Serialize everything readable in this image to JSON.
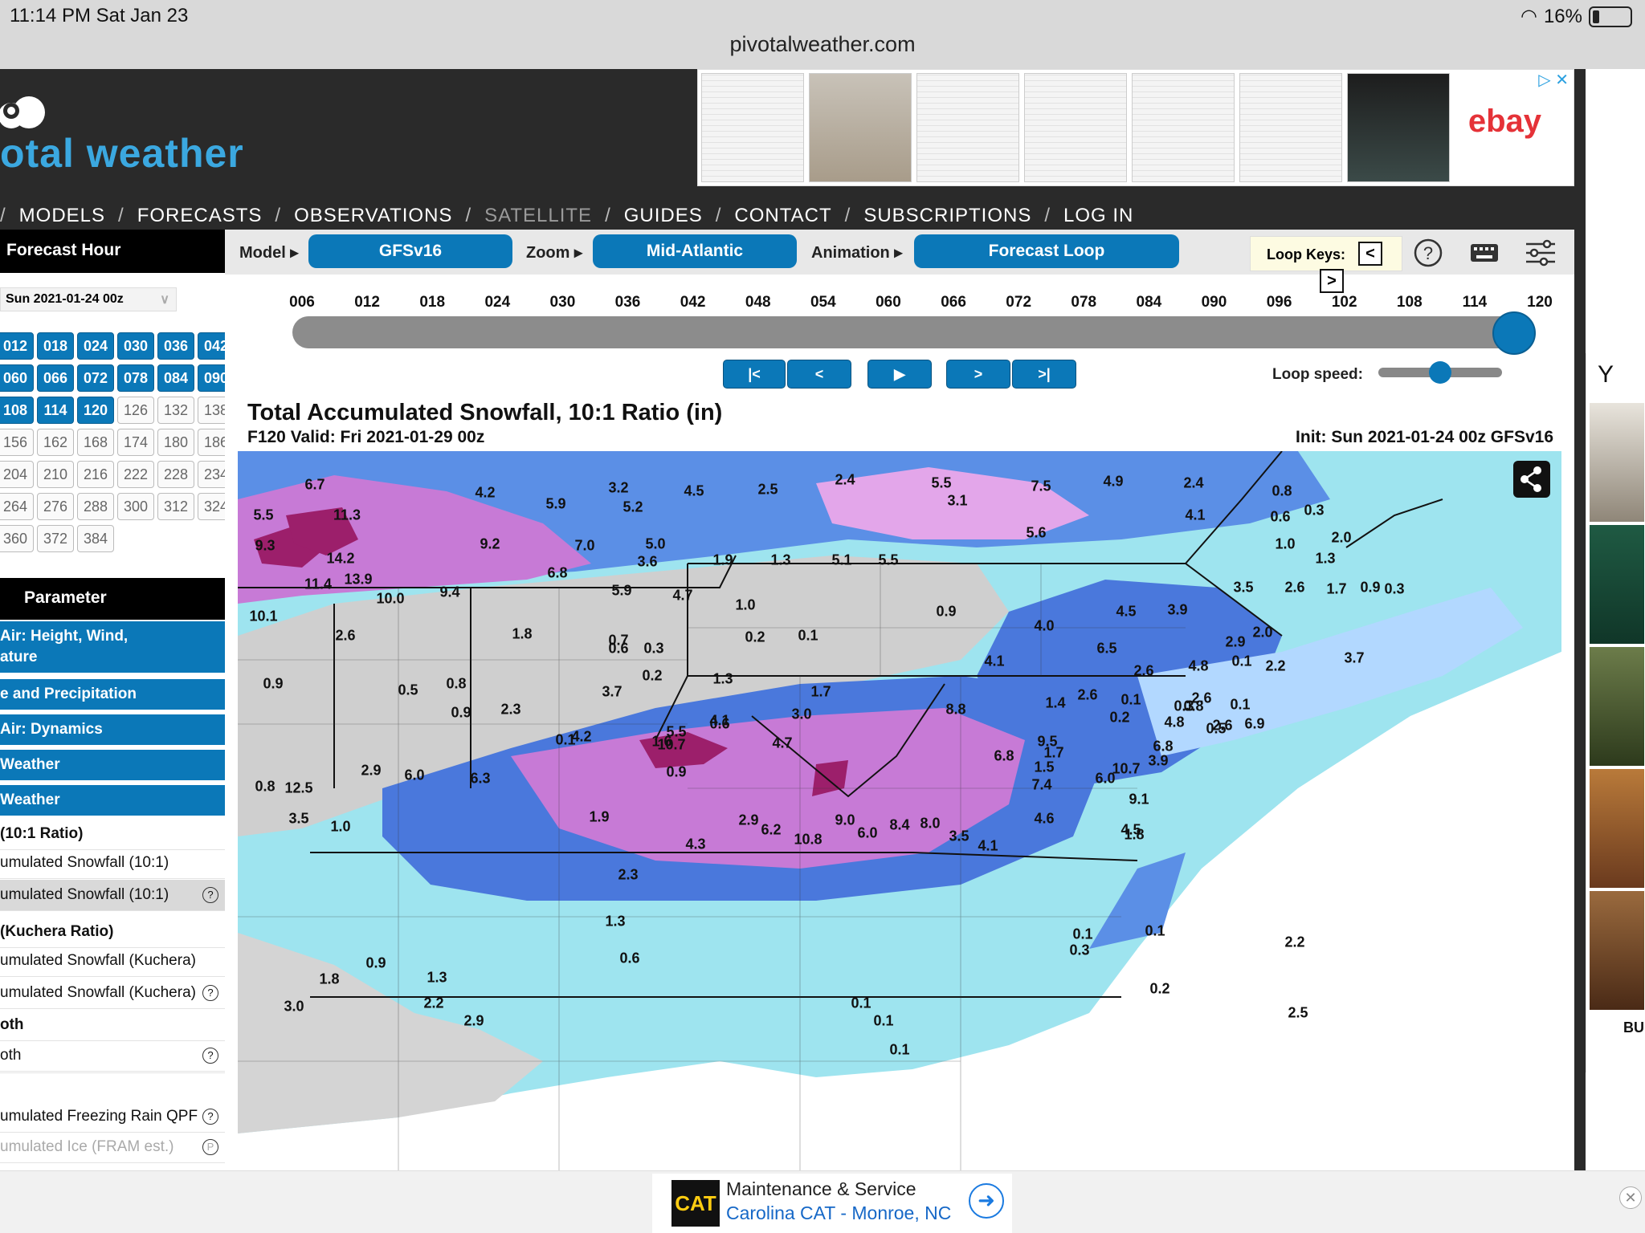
{
  "status_bar": {
    "time": "11:14 PM   Sat Jan 23",
    "battery": "16%",
    "url": "pivotalweather.com"
  },
  "header": {
    "logo_text": "otal weather"
  },
  "nav": [
    "MODELS",
    "FORECASTS",
    "OBSERVATIONS",
    "SATELLITE",
    "GUIDES",
    "CONTACT",
    "SUBSCRIPTIONS",
    "LOG IN"
  ],
  "top_ad": {
    "brand": "ebay"
  },
  "sidebar": {
    "forecast_hour_title": "Forecast Hour",
    "run_select": "Sun 2021-01-24 00z",
    "hours": [
      [
        "012",
        "018",
        "024",
        "030",
        "036",
        "042"
      ],
      [
        "060",
        "066",
        "072",
        "078",
        "084",
        "090"
      ],
      [
        "108",
        "114",
        "120",
        "126",
        "132",
        "138"
      ],
      [
        "156",
        "162",
        "168",
        "174",
        "180",
        "186"
      ],
      [
        "204",
        "210",
        "216",
        "222",
        "228",
        "234"
      ],
      [
        "264",
        "276",
        "288",
        "300",
        "312",
        "324"
      ],
      [
        "360",
        "372",
        "384"
      ]
    ],
    "parameter_title": "Parameter",
    "categories": [
      "Air: Height, Wind,\nature",
      "e and Precipitation",
      "Air: Dynamics",
      "Weather",
      "Weather"
    ],
    "items": [
      {
        "label": "(10:1 Ratio)",
        "bold": true
      },
      {
        "label": "umulated Snowfall (10:1)"
      },
      {
        "label": "umulated Snowfall (10:1)",
        "selected": true,
        "help": "?"
      },
      {
        "label": "(Kuchera Ratio)",
        "bold": true
      },
      {
        "label": "umulated Snowfall (Kuchera)"
      },
      {
        "label": "umulated Snowfall (Kuchera)",
        "help": "?"
      },
      {
        "label": "oth",
        "bold": true
      },
      {
        "label": "oth",
        "help": "?"
      },
      {
        "label": ""
      },
      {
        "label": "umulated Freezing Rain QPF",
        "help": "?"
      },
      {
        "label": "umulated Ice (FRAM est.)",
        "dim": true,
        "help": "P"
      }
    ]
  },
  "controls": {
    "model_label": "Model ▸",
    "model_value": "GFSv16",
    "zoom_label": "Zoom ▸",
    "zoom_value": "Mid-Atlantic",
    "animation_label": "Animation ▸",
    "animation_value": "Forecast Loop",
    "loop_keys_label": "Loop Keys:",
    "key_prev": "<",
    "key_next": ">"
  },
  "timeline": {
    "hours": [
      "006",
      "012",
      "018",
      "024",
      "030",
      "036",
      "042",
      "048",
      "054",
      "060",
      "066",
      "072",
      "078",
      "084",
      "090",
      "096",
      "102",
      "108",
      "114",
      "120"
    ],
    "current": "120",
    "position": 1.0,
    "buttons": [
      "|<",
      "<",
      "▶",
      ">",
      ">|"
    ],
    "loop_speed_label": "Loop speed:",
    "loop_speed_level": 0.45
  },
  "map": {
    "title": "Total Accumulated Snowfall, 10:1 Ratio (in)",
    "valid": "F120 Valid: Fri 2021-01-29 00z",
    "init": "Init: Sun 2021-01-24 00z GFSv16",
    "values": [
      "6.7",
      "4.2",
      "3.2",
      "4.5",
      "2.5",
      "2.4",
      "5.5",
      "7.5",
      "4.9",
      "2.4",
      "0.8",
      "5.5",
      "11.3",
      "5.9",
      "5.2",
      "3.1",
      "4.1",
      "0.6",
      "0.3",
      "9.3",
      "14.2",
      "9.2",
      "7.0",
      "5.0",
      "5.6",
      "1.0",
      "2.0",
      "11.4",
      "13.9",
      "6.8",
      "3.6",
      "1.9",
      "1.3",
      "5.1",
      "5.5",
      "1.3",
      "10.1",
      "10.0",
      "9.4",
      "5.9",
      "4.7",
      "1.0",
      "0.9",
      "2.6",
      "1.7",
      "0.9",
      "0.3",
      "2.6",
      "1.8",
      "0.7",
      "0.2",
      "0.1",
      "4.0",
      "4.5",
      "3.9",
      "3.5",
      "2.9",
      "2.0",
      "0.6",
      "0.3",
      "6.5",
      "2.2",
      "0.9",
      "0.5",
      "0.8",
      "0.2",
      "1.3",
      "4.1",
      "2.6",
      "4.8",
      "0.1",
      "0.6",
      "0.9",
      "2.3",
      "3.7",
      "4.1",
      "1.7",
      "1.4",
      "0.1",
      "0.3",
      "0.1",
      "0.1",
      "1.6",
      "4.2",
      "3.0",
      "2.6",
      "0.2",
      "0.8",
      "2.6",
      "5.5",
      "4.7",
      "3.9",
      "4.8",
      "0.5",
      "0.8",
      "2.9",
      "6.0",
      "6.3",
      "0.9",
      "8.8",
      "6.8",
      "1.0",
      "12.5",
      "10.7",
      "1.7",
      "3.7",
      "6.9",
      "10.8",
      "9.5",
      "6.8",
      "1.5",
      "4.5",
      "6.0",
      "10.7",
      "1.9",
      "2.9",
      "9.0",
      "8.4",
      "8.0",
      "7.4",
      "9.1",
      "1.8",
      "3.5",
      "2.3",
      "4.3",
      "6.2",
      "6.0",
      "3.5",
      "4.1",
      "4.6",
      "2.6",
      "3.0",
      "2.2",
      "2.9",
      "1.3",
      "0.6",
      "2.2",
      "0.2",
      "1.3",
      "1.8",
      "0.9",
      "0.3",
      "0.1",
      "0.1",
      "0.1",
      "0.1",
      "0.1",
      "2.5"
    ]
  },
  "right_ad": {
    "header": "Y",
    "footer": "BU"
  },
  "bottom_ad": {
    "logo": "CAT",
    "line1": "Maintenance & Service",
    "line2": "Carolina CAT - Monroe, NC"
  }
}
